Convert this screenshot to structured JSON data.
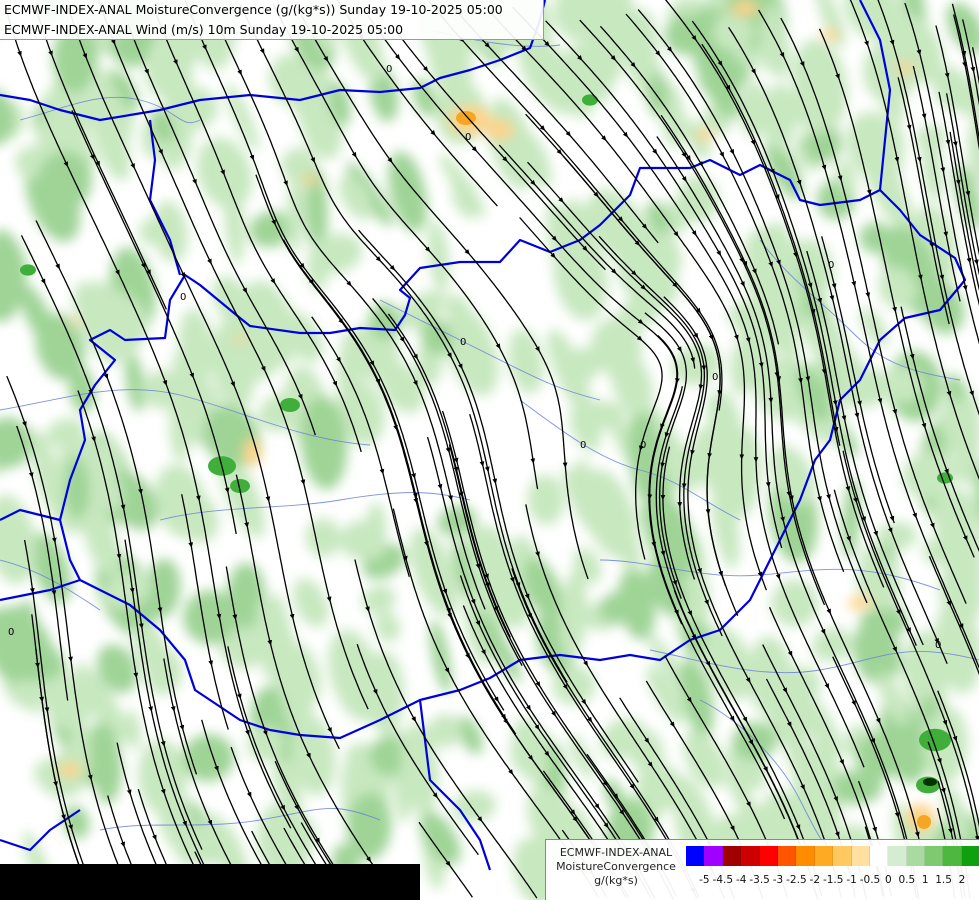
{
  "header": {
    "line1": "ECMWF-INDEX-ANAL MoistureConvergence (g/(kg*s)) Sunday 19-10-2025 05:00",
    "line2": "ECMWF-INDEX-ANAL Wind (m/s) 10m Sunday 19-10-2025 05:00"
  },
  "legend": {
    "model": "ECMWF-INDEX-ANAL",
    "parameter": "MoistureConvergence",
    "unit": "g/(kg*s)",
    "colors": [
      "#0000ff",
      "#9f00ff",
      "#a00000",
      "#cc0000",
      "#ff0000",
      "#ff5500",
      "#ff8c00",
      "#ffaa22",
      "#ffc860",
      "#ffe0a0",
      "#ffffff",
      "#d4ecd0",
      "#a9dba0",
      "#7fca70",
      "#4cb840",
      "#0f9f0f"
    ],
    "tick_labels": [
      "-5",
      "-4.5",
      "-4",
      "-3.5",
      "-3",
      "-2.5",
      "-2",
      "-1.5",
      "-1",
      "-0.5",
      "0",
      "0.5",
      "1",
      "1.5",
      "2"
    ]
  },
  "map": {
    "contour_label": "0",
    "colors": {
      "green_light": "#c8e8c0",
      "green_mid": "#9fd496",
      "green_dark": "#3fae3a",
      "orange_light": "#ffd38a",
      "orange_mid": "#f5a623",
      "border": "#0000dd",
      "river": "#6a7fd8",
      "streamline": "#000000"
    }
  }
}
